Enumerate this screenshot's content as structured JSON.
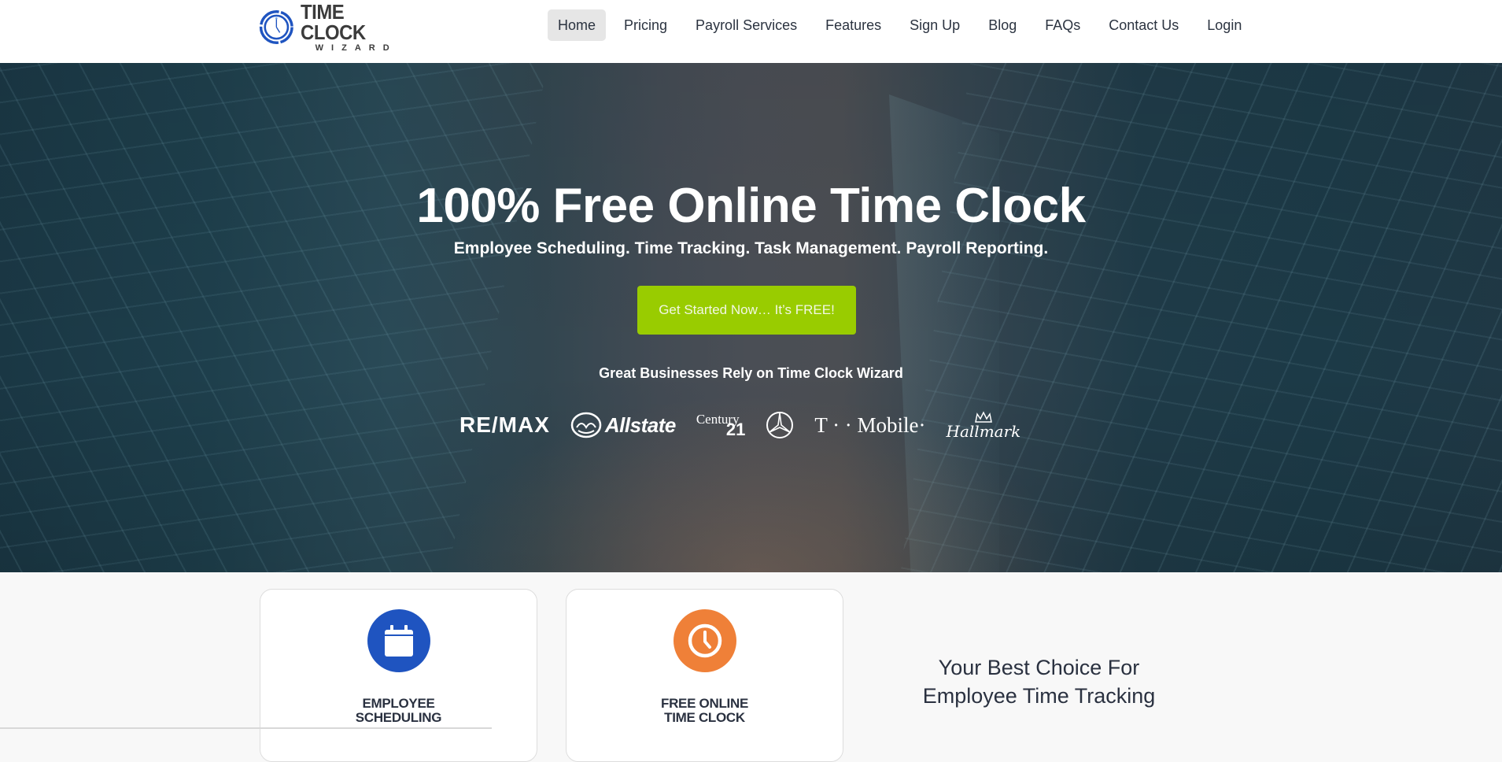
{
  "brand": {
    "name": "TIME CLOCK",
    "subname": "WIZARD",
    "accent_color": "#1f54c0"
  },
  "nav": {
    "items": [
      {
        "label": "Home",
        "active": true
      },
      {
        "label": "Pricing",
        "active": false
      },
      {
        "label": "Payroll Services",
        "active": false
      },
      {
        "label": "Features",
        "active": false
      },
      {
        "label": "Sign Up",
        "active": false
      },
      {
        "label": "Blog",
        "active": false
      },
      {
        "label": "FAQs",
        "active": false
      },
      {
        "label": "Contact Us",
        "active": false
      },
      {
        "label": "Login",
        "active": false
      }
    ]
  },
  "hero": {
    "title": "100% Free Online Time Clock",
    "subtitle": "Employee Scheduling. Time Tracking. Task Management. Payroll Reporting.",
    "cta_label": "Get Started Now… It’s FREE!",
    "cta_color": "#99cc00",
    "rely_text": "Great Businesses Rely on Time Clock Wizard",
    "client_logos": {
      "remax": "RE/MAX",
      "allstate": "Allstate",
      "century21_word": "Century",
      "century21_num": "21",
      "mercedes": "Mercedes-Benz",
      "tmobile": "T · · Mobile·",
      "hallmark": "Hallmark"
    }
  },
  "features": {
    "cards": [
      {
        "title_line1": "EMPLOYEE",
        "title_line2": "SCHEDULING",
        "icon": "calendar-icon",
        "color": "#1f54c0"
      },
      {
        "title_line1": "FREE ONLINE",
        "title_line2": "TIME CLOCK",
        "icon": "clock-icon",
        "color": "#ef8038"
      }
    ],
    "tagline_line1": "Your Best Choice For",
    "tagline_line2": "Employee Time Tracking"
  }
}
